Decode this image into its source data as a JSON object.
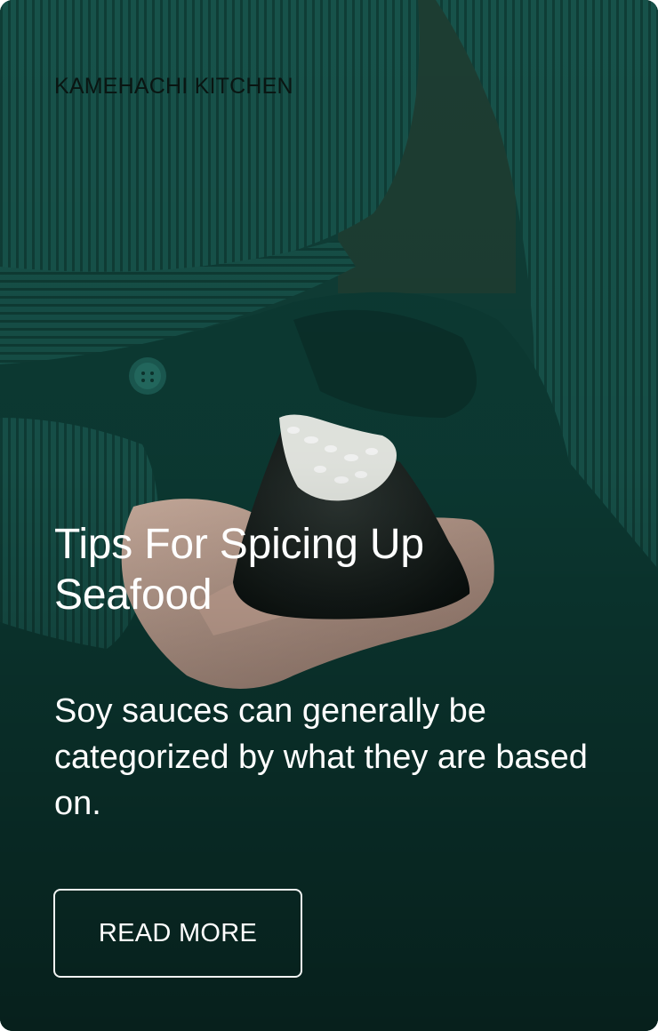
{
  "card": {
    "brand": "KAMEHACHI KITCHEN",
    "title": "Tips For Spicing Up Seafood",
    "excerpt": "Soy sauces can generally be categorized by what they are based on.",
    "cta_label": "READ MORE"
  },
  "colors": {
    "background": "#0f3f37",
    "text": "#ffffff",
    "brand_text": "#0a1512",
    "button_border": "#f2f4f3"
  },
  "icons": {
    "hero_image": "onigiri-in-hand-photo"
  }
}
